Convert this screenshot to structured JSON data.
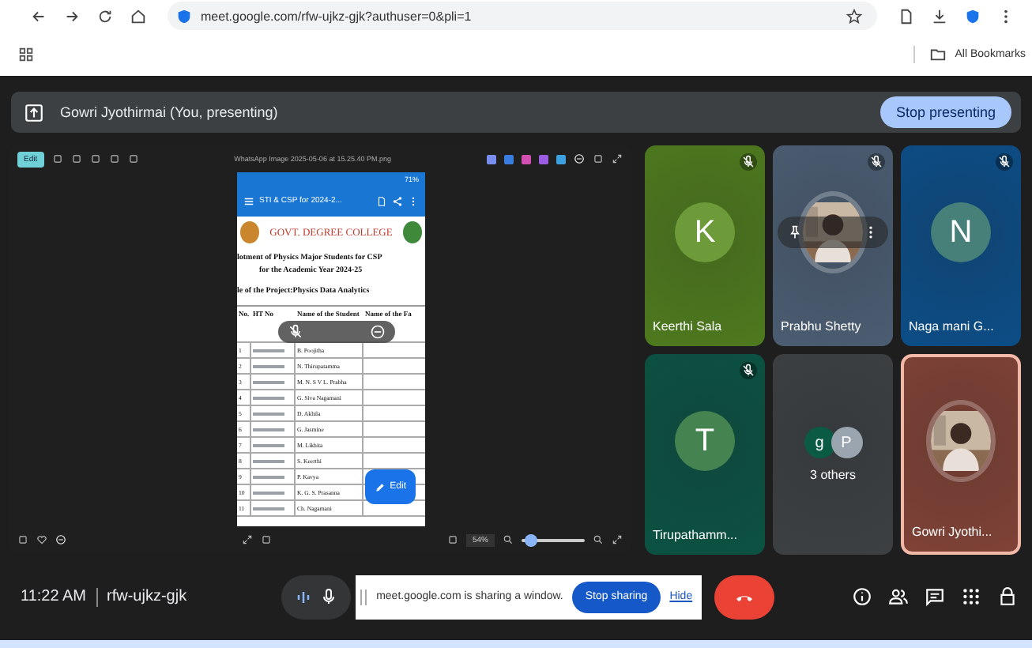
{
  "browser": {
    "url": "meet.google.com/rfw-ujkz-gjk?authuser=0&pli=1",
    "bookmarks": "All Bookmarks"
  },
  "presenting_bar": {
    "label": "Gowri Jyothirmai (You, presenting)",
    "button": "Stop presenting"
  },
  "shared_window": {
    "edit_label": "Edit",
    "zoom_slider": {
      "level": 0.15
    },
    "title": "WhatsApp Image 2025-05-06 at 15.25.40 PM.png",
    "zoom": "54%",
    "phone": {
      "battery": "71%",
      "app_title": "STI & CSP for 2024-2...",
      "college": "GOVT. DEGREE COLLEGE",
      "headings": [
        "lotment of Physics Major Students for CSP",
        "for the Academic Year 2024-25",
        "le of the Project:Physics Data Analytics"
      ],
      "columns": [
        "No.",
        "HT No",
        "Name of the Student",
        "Name of the Fa"
      ],
      "rows": [
        {
          "no": "1",
          "name": "B. Poojitha"
        },
        {
          "no": "2",
          "name": "N. Thirupatamma"
        },
        {
          "no": "3",
          "name": "M. N. S V L. Prabha"
        },
        {
          "no": "4",
          "name": "G. Siva Nagamani"
        },
        {
          "no": "5",
          "name": "D. Akhila"
        },
        {
          "no": "6",
          "name": "G. Jasmine"
        },
        {
          "no": "7",
          "name": "M. Likhita"
        },
        {
          "no": "8",
          "name": "S. Keerthi"
        },
        {
          "no": "9",
          "name": "P. Kavya"
        },
        {
          "no": "10",
          "name": "K. G. S. Prasanna"
        },
        {
          "no": "11",
          "name": "Ch. Nagamani"
        }
      ],
      "fab": "Edit"
    }
  },
  "tiles": [
    {
      "kind": "avatar",
      "name": "Keerthi Sala",
      "initial": "K",
      "color": "#4e7a1e",
      "muted": true
    },
    {
      "name": "Prabhu Shetty",
      "color": "#4b5d72",
      "muted": true,
      "hovered": true
    },
    {
      "kind": "avatar",
      "name": "Naga mani G...",
      "initial": "N",
      "color": "#0c4d86",
      "muted": true
    },
    {
      "kind": "avatar",
      "name": "Tirupathamm...",
      "initial": "T",
      "color": "#0b5243",
      "muted": true
    },
    {
      "kind": "others",
      "label": "3 others",
      "initials": [
        "g",
        "P"
      ],
      "color": "#3c4043",
      "muted": false
    },
    {
      "name": "Gowri Jyothi...",
      "color": "#7f4236",
      "muted": false,
      "hovered": false,
      "self": true
    }
  ],
  "bottom_bar": {
    "time": "11:22 AM",
    "meeting_code": "rfw-ujkz-gjk"
  },
  "share_banner": {
    "message": "meet.google.com is sharing a window.",
    "button": "Stop sharing",
    "link": "Hide"
  }
}
